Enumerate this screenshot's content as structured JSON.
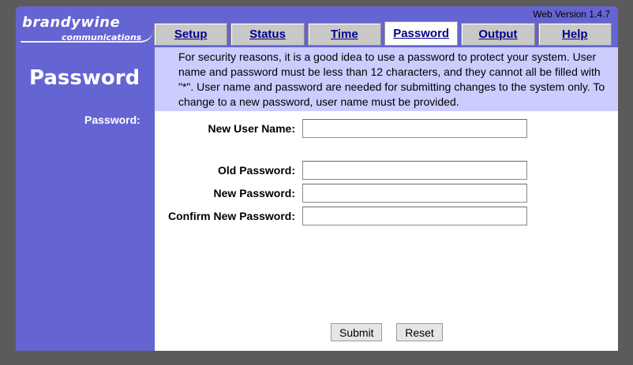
{
  "brand": {
    "line1": "brandywine",
    "line2": "communications"
  },
  "version": "Web Version 1.4.7",
  "tabs": [
    {
      "label": "Setup"
    },
    {
      "label": "Status"
    },
    {
      "label": "Time"
    },
    {
      "label": "Password"
    },
    {
      "label": "Output"
    },
    {
      "label": "Help"
    }
  ],
  "active_tab": "Password",
  "page_title": "Password",
  "info_text": "For security reasons, it is a good idea to use a password to protect your system. User name and password must be less than 12 characters, and they cannot all be filled with \"*\". User name and password are needed for submitting changes to the system only. To change to a new password, user name must be provided.",
  "sidebar_label": "Password:",
  "form": {
    "new_user_name": {
      "label": "New User Name:",
      "value": ""
    },
    "old_password": {
      "label": "Old Password:",
      "value": ""
    },
    "new_password": {
      "label": "New Password:",
      "value": ""
    },
    "confirm_password": {
      "label": "Confirm New Password:",
      "value": ""
    }
  },
  "buttons": {
    "submit": "Submit",
    "reset": "Reset"
  },
  "colors": {
    "frame": "#6464d2",
    "info_bg": "#ccccff",
    "tab_link": "#00008b",
    "background": "#5b5b5b"
  }
}
